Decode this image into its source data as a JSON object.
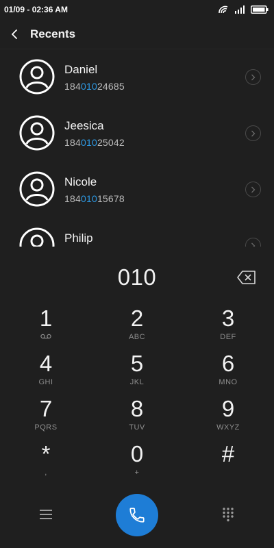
{
  "status_bar": {
    "datetime": "01/09 - 02:36 AM",
    "icons": [
      "wifi-icon",
      "signal-icon",
      "battery-icon"
    ]
  },
  "header": {
    "title": "Recents",
    "back_icon": "back-arrow-icon"
  },
  "recents": [
    {
      "name": "Daniel",
      "number_prefix": "184",
      "number_match": "010",
      "number_suffix": "24685"
    },
    {
      "name": "Jeesica",
      "number_prefix": "184",
      "number_match": "010",
      "number_suffix": "25042"
    },
    {
      "name": "Nicole",
      "number_prefix": "184",
      "number_match": "010",
      "number_suffix": "15678"
    },
    {
      "name": "Philip",
      "number_prefix": "",
      "number_match": "",
      "number_suffix": ""
    }
  ],
  "dialer": {
    "input_value": "010",
    "backspace_icon": "backspace-icon"
  },
  "keypad": [
    {
      "digit": "1",
      "letters": "",
      "icon": "voicemail-icon"
    },
    {
      "digit": "2",
      "letters": "ABC"
    },
    {
      "digit": "3",
      "letters": "DEF"
    },
    {
      "digit": "4",
      "letters": "GHI"
    },
    {
      "digit": "5",
      "letters": "JKL"
    },
    {
      "digit": "6",
      "letters": "MNO"
    },
    {
      "digit": "7",
      "letters": "PQRS"
    },
    {
      "digit": "8",
      "letters": "TUV"
    },
    {
      "digit": "9",
      "letters": "WXYZ"
    },
    {
      "digit": "*",
      "letters": ","
    },
    {
      "digit": "0",
      "letters": "+"
    },
    {
      "digit": "#",
      "letters": ""
    }
  ],
  "bottom_bar": {
    "menu_icon": "menu-icon",
    "call_icon": "phone-icon",
    "keypad_icon": "dialpad-icon"
  },
  "colors": {
    "background": "#1f1f1f",
    "accent": "#1e7dd6",
    "match_highlight": "#2d9be6"
  }
}
